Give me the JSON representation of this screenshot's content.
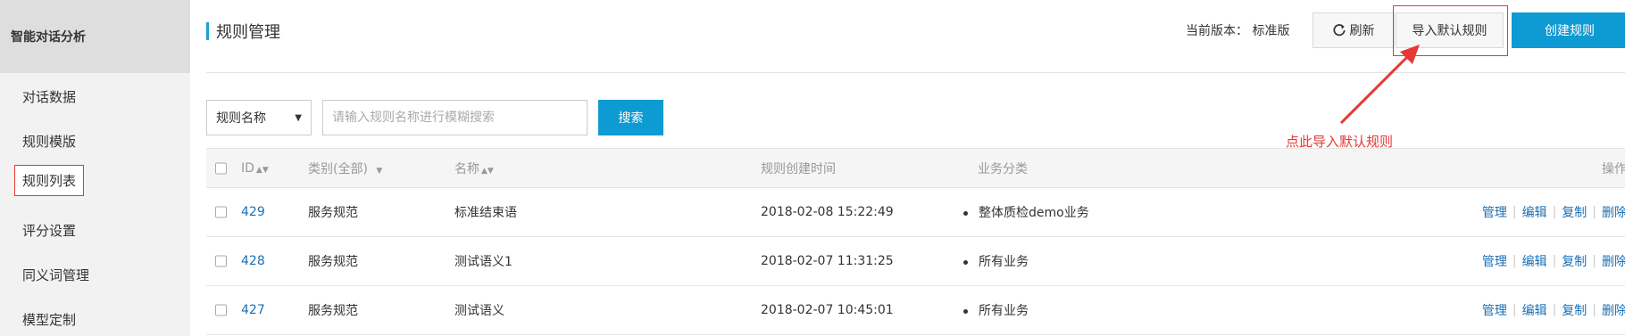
{
  "sidebar": {
    "title": "智能对话分析",
    "items": [
      {
        "label": "对话数据"
      },
      {
        "label": "规则模版"
      },
      {
        "label": "规则列表"
      },
      {
        "label": "评分设置"
      },
      {
        "label": "同义词管理"
      },
      {
        "label": "模型定制"
      }
    ]
  },
  "header": {
    "title": "规则管理",
    "version_label": "当前版本：",
    "version_value": "标准版",
    "refresh_label": "刷新",
    "import_label": "导入默认规则",
    "create_label": "创建规则"
  },
  "filter": {
    "select_value": "规则名称",
    "search_placeholder": "请输入规则名称进行模糊搜索",
    "search_button": "搜索"
  },
  "annotation": "点此导入默认规则",
  "table": {
    "columns": {
      "id": "ID",
      "category": "类别(全部)",
      "name": "名称",
      "created": "规则创建时间",
      "business": "业务分类",
      "ops": "操作"
    },
    "rows": [
      {
        "id": "429",
        "category": "服务规范",
        "name": "标准结束语",
        "created": "2018-02-08 15:22:49",
        "business": "整体质检demo业务"
      },
      {
        "id": "428",
        "category": "服务规范",
        "name": "测试语义1",
        "created": "2018-02-07 11:31:25",
        "business": "所有业务"
      },
      {
        "id": "427",
        "category": "服务规范",
        "name": "测试语义",
        "created": "2018-02-07 10:45:01",
        "business": "所有业务"
      }
    ],
    "ops": {
      "manage": "管理",
      "edit": "编辑",
      "copy": "复制",
      "delete": "删除"
    }
  },
  "colors": {
    "accent": "#0e9ad2",
    "highlight": "#e53935",
    "link": "#1a6fb5"
  }
}
